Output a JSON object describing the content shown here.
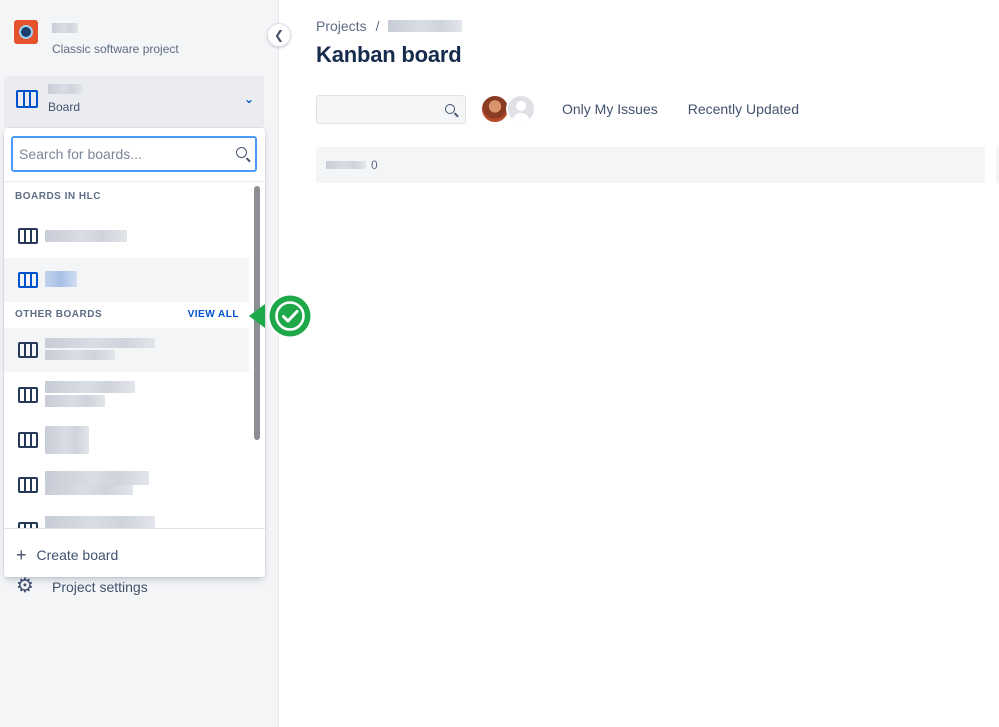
{
  "sidebar": {
    "project_subtitle": "Classic software project",
    "board_selector_label": "Board",
    "settings_label": "Project settings"
  },
  "board_dropdown": {
    "search_placeholder": "Search for boards...",
    "section_current": "BOARDS IN HLC",
    "section_other": "OTHER BOARDS",
    "view_all_label": "VIEW ALL",
    "create_board_label": "Create board"
  },
  "main": {
    "breadcrumb_root": "Projects",
    "breadcrumb_separator": "/",
    "title": "Kanban board",
    "quick_filters": [
      "Only My Issues",
      "Recently Updated"
    ],
    "column_count": "0"
  },
  "colors": {
    "accent": "#0052cc",
    "callout_green": "#1ea84a"
  }
}
